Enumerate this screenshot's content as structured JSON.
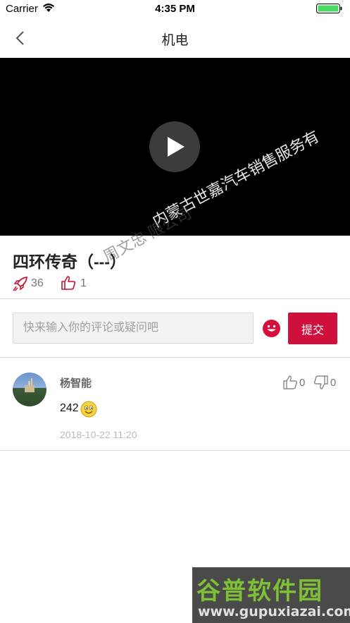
{
  "status_bar": {
    "carrier": "Carrier",
    "time": "4:35 PM"
  },
  "nav": {
    "title": "机电"
  },
  "video": {
    "watermark_line1": "内蒙古世嘉汽车销售服务有",
    "watermark_line2": "周文忠   限公司"
  },
  "content": {
    "title": "四环传奇（---）",
    "share_count": "36",
    "like_count": "1"
  },
  "comment_form": {
    "placeholder": "快来输入你的评论或疑问吧",
    "submit_label": "提交"
  },
  "comments": [
    {
      "author": "杨智能",
      "text": "242",
      "date": "2018-10-22 11:20",
      "upvotes": "0",
      "downvotes": "0"
    }
  ],
  "logo": {
    "brand": "谷普软件园",
    "url": "www.gupuxiazai.com"
  },
  "colors": {
    "accent": "#d0103c",
    "background": "#ffffff",
    "video_bg": "#000000"
  }
}
